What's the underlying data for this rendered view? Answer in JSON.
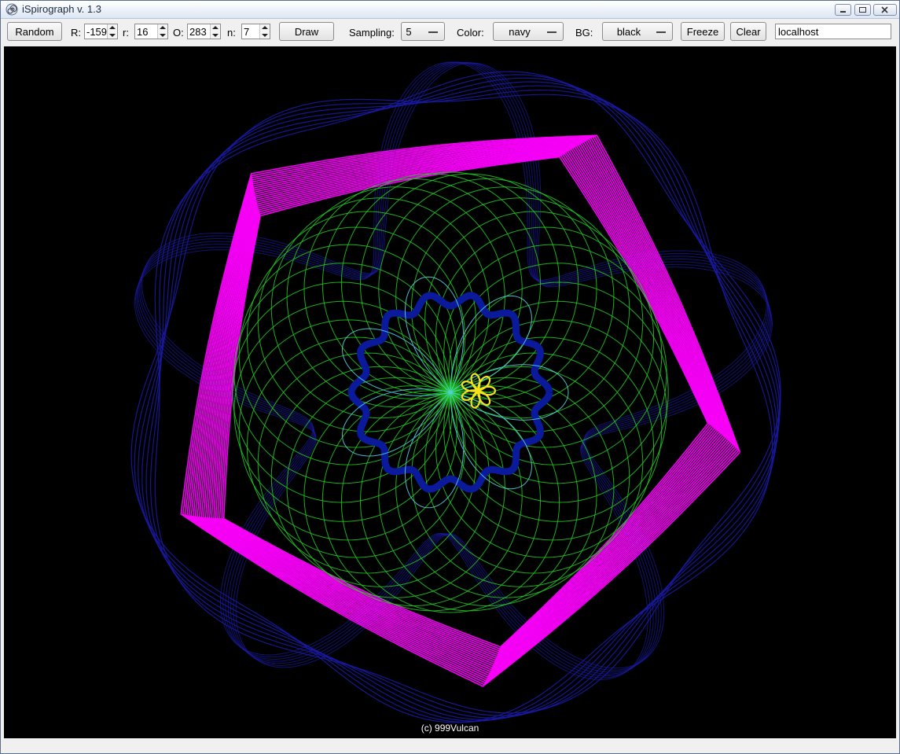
{
  "window": {
    "title": "iSpirograph v. 1.3"
  },
  "toolbar": {
    "random_label": "Random",
    "r_big_label": "R:",
    "r_big_value": "-159",
    "r_small_label": "r:",
    "r_small_value": "16",
    "o_label": "O:",
    "o_value": "283",
    "n_label": "n:",
    "n_value": "7",
    "draw_label": "Draw",
    "sampling_label": "Sampling:",
    "sampling_value": "5",
    "color_label": "Color:",
    "color_value": "navy",
    "bg_label": "BG:",
    "bg_value": "black",
    "freeze_label": "Freeze",
    "clear_label": "Clear",
    "host_value": "localhost"
  },
  "canvas": {
    "credit": "(c) 999Vulcan",
    "background": "#000000",
    "curve_colors": {
      "outer": "#1a1aa0",
      "pentagon": "#ff00ff",
      "sphere": "#22cc22",
      "inner_ring": "#0a1a9a",
      "rosette": "#55cfe0",
      "star": "#f5e21a"
    }
  }
}
